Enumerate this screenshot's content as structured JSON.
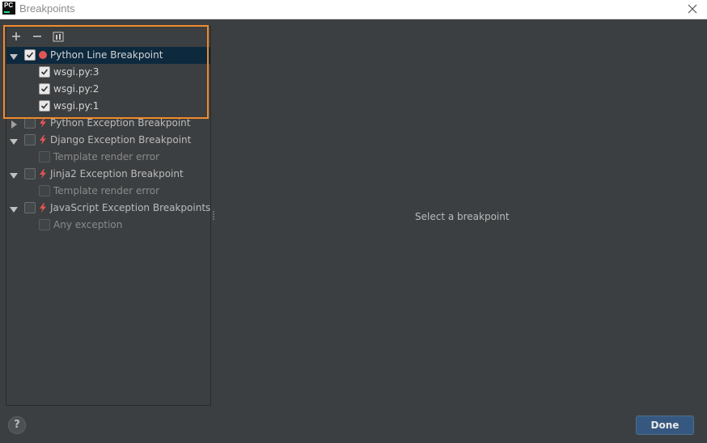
{
  "window": {
    "title": "Breakpoints"
  },
  "toolbar": {
    "add": "add-icon",
    "remove": "remove-icon",
    "group": "group-icon"
  },
  "tree": {
    "python_line": {
      "label": "Python Line Breakpoint",
      "children": [
        "wsgi.py:3",
        "wsgi.py:2",
        "wsgi.py:1"
      ]
    },
    "python_exception": {
      "label": "Python Exception Breakpoint"
    },
    "django_exception": {
      "label": "Django Exception Breakpoint",
      "child": "Template render error"
    },
    "jinja2_exception": {
      "label": "Jinja2 Exception Breakpoint",
      "child": "Template render error"
    },
    "javascript_exception": {
      "label": "JavaScript Exception Breakpoints",
      "child": "Any exception"
    }
  },
  "detail": {
    "message": "Select a breakpoint"
  },
  "footer": {
    "help_label": "?",
    "done_label": "Done"
  },
  "colors": {
    "accent": "#365880",
    "highlight": "#f08a2c",
    "breakpoint_red": "#e05555"
  }
}
